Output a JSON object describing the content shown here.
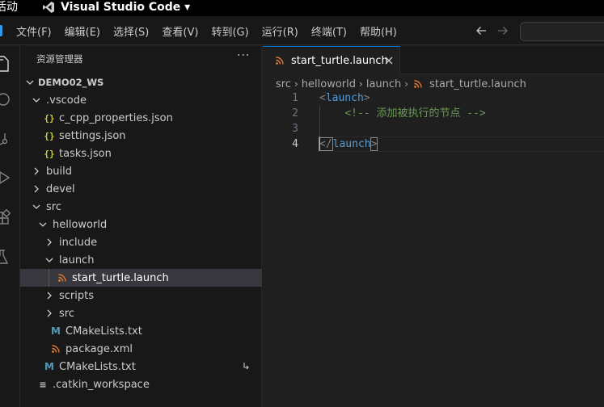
{
  "system_bar": {
    "activities": "活动",
    "app_title": "Visual Studio Code",
    "app_title_dropdown_icon": "caret-down-icon"
  },
  "menu": {
    "items": [
      "文件(F)",
      "编辑(E)",
      "选择(S)",
      "查看(V)",
      "转到(G)",
      "运行(R)",
      "终端(T)",
      "帮助(H)"
    ],
    "back_icon": "arrow-left-icon",
    "forward_icon": "arrow-right-icon"
  },
  "activity_bar": {
    "icons": [
      "explorer-icon",
      "search-icon",
      "source-control-icon",
      "run-debug-icon",
      "extensions-icon",
      "testing-icon"
    ]
  },
  "explorer": {
    "header": "资源管理器",
    "more_icon": "ellipsis-icon",
    "root": "DEMO02_WS",
    "items": [
      {
        "label": ".vscode",
        "type": "folder",
        "expanded": true,
        "depth": 1
      },
      {
        "label": "c_cpp_properties.json",
        "type": "json",
        "depth": 2
      },
      {
        "label": "settings.json",
        "type": "json",
        "depth": 2
      },
      {
        "label": "tasks.json",
        "type": "json",
        "depth": 2
      },
      {
        "label": "build",
        "type": "folder",
        "expanded": false,
        "depth": 1
      },
      {
        "label": "devel",
        "type": "folder",
        "expanded": false,
        "depth": 1
      },
      {
        "label": "src",
        "type": "folder",
        "expanded": true,
        "depth": 1
      },
      {
        "label": "helloworld",
        "type": "folder",
        "expanded": true,
        "depth": 2
      },
      {
        "label": "include",
        "type": "folder",
        "expanded": false,
        "depth": 3
      },
      {
        "label": "launch",
        "type": "folder",
        "expanded": true,
        "depth": 3
      },
      {
        "label": "start_turtle.launch",
        "type": "launch",
        "depth": 4,
        "selected": true
      },
      {
        "label": "scripts",
        "type": "folder",
        "expanded": false,
        "depth": 3
      },
      {
        "label": "src",
        "type": "folder",
        "expanded": false,
        "depth": 3
      },
      {
        "label": "CMakeLists.txt",
        "type": "cmake",
        "depth": 3
      },
      {
        "label": "package.xml",
        "type": "launch",
        "depth": 3
      },
      {
        "label": "CMakeLists.txt",
        "type": "cmake",
        "depth": 2,
        "symlink": true
      },
      {
        "label": ".catkin_workspace",
        "type": "text",
        "depth": 1
      }
    ]
  },
  "editor": {
    "tab_label": "start_turtle.launch",
    "close_icon": "close-icon",
    "breadcrumb": [
      "src",
      "helloworld",
      "launch",
      "start_turtle.launch"
    ],
    "line_numbers": [
      "1",
      "2",
      "3",
      "4"
    ],
    "active_line": "4",
    "code": {
      "l1_open": "<",
      "l1_tag": "launch",
      "l1_close": ">",
      "l2_comment": "<!-- 添加被执行的节点 -->",
      "l4_open": "</",
      "l4_tag": "launch",
      "l4_close": ">"
    }
  },
  "colors": {
    "accent": "#0078d4",
    "tag": "#569cd6",
    "comment": "#6a9955",
    "json_icon": "#cbcb41",
    "cmake_icon": "#519aba",
    "launch_icon": "#e37933"
  }
}
